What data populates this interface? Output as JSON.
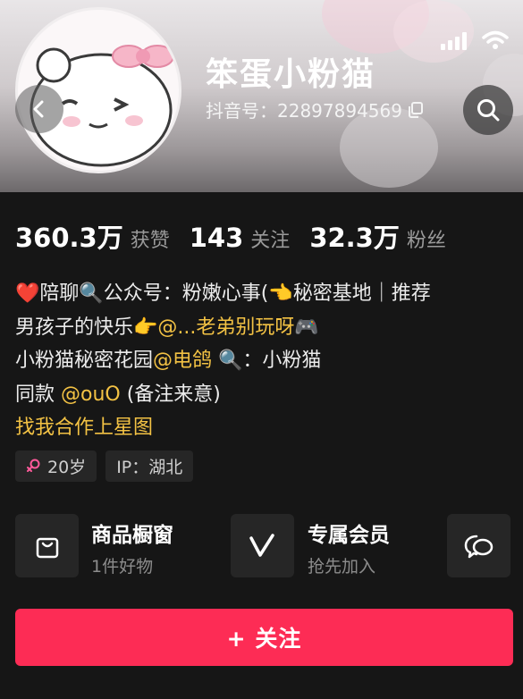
{
  "profile": {
    "nickname": "笨蛋小粉猫",
    "douyin_id": "抖音号：22897894569"
  },
  "stats": [
    {
      "value": "360.3万",
      "label": "获赞"
    },
    {
      "value": "143",
      "label": "关注"
    },
    {
      "value": "32.3万",
      "label": "粉丝"
    }
  ],
  "bio": {
    "line1_a": "❤️陪聊🔍公众号：粉嫩心事(👈秘密基地｜推荐",
    "line2_a": "男孩子的快乐👉",
    "line2_mention": "@...老弟别玩呀",
    "line2_b": "🎮",
    "line3_a": "小粉猫秘密花园",
    "line3_mention": "@电鸽",
    "line3_b": " 🔍：小粉猫",
    "line4_a": "同款 ",
    "line4_mention": "@ouO",
    "line4_b": " (备注来意)",
    "cooperation_link": "找我合作上星图"
  },
  "tags": {
    "gender_icon": "female-icon",
    "age": "20岁",
    "ip": "IP：湖北"
  },
  "cards": [
    {
      "icon": "shopping-bag-icon",
      "title": "商品橱窗",
      "subtitle": "1件好物"
    },
    {
      "icon": "vip-v-icon",
      "title": "专属会员",
      "subtitle": "抢先加入"
    },
    {
      "icon": "chat-bubble-icon"
    }
  ],
  "follow_button": "+ 关注",
  "colors": {
    "accent": "#fd2c55",
    "mention": "#f3c244",
    "background": "#161616"
  }
}
